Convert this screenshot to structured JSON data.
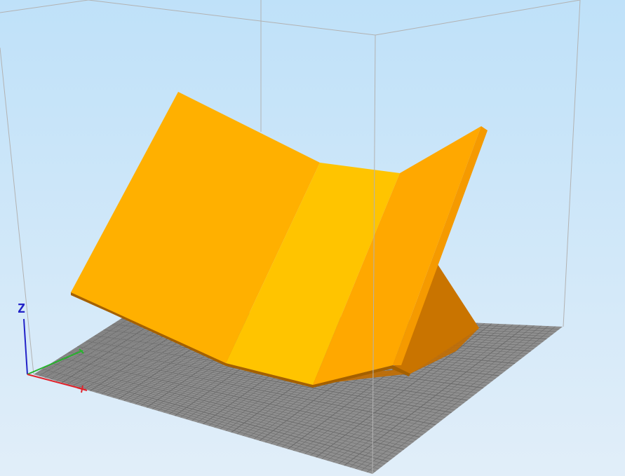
{
  "viewport": {
    "background_top": "#bfe1f9",
    "background_bottom": "#e1eef9"
  },
  "axes": {
    "z_label": "Z",
    "x_color": "#e0242c",
    "y_color": "#27b32d",
    "z_color": "#2323c8"
  },
  "model": {
    "color": "#ffb000",
    "shadow_color": "#c26d00"
  },
  "bed": {
    "color": "#8f8f8f",
    "grid_color": "#6a6a6a"
  },
  "build_volume": {
    "edge_color": "#b2b2b2"
  }
}
